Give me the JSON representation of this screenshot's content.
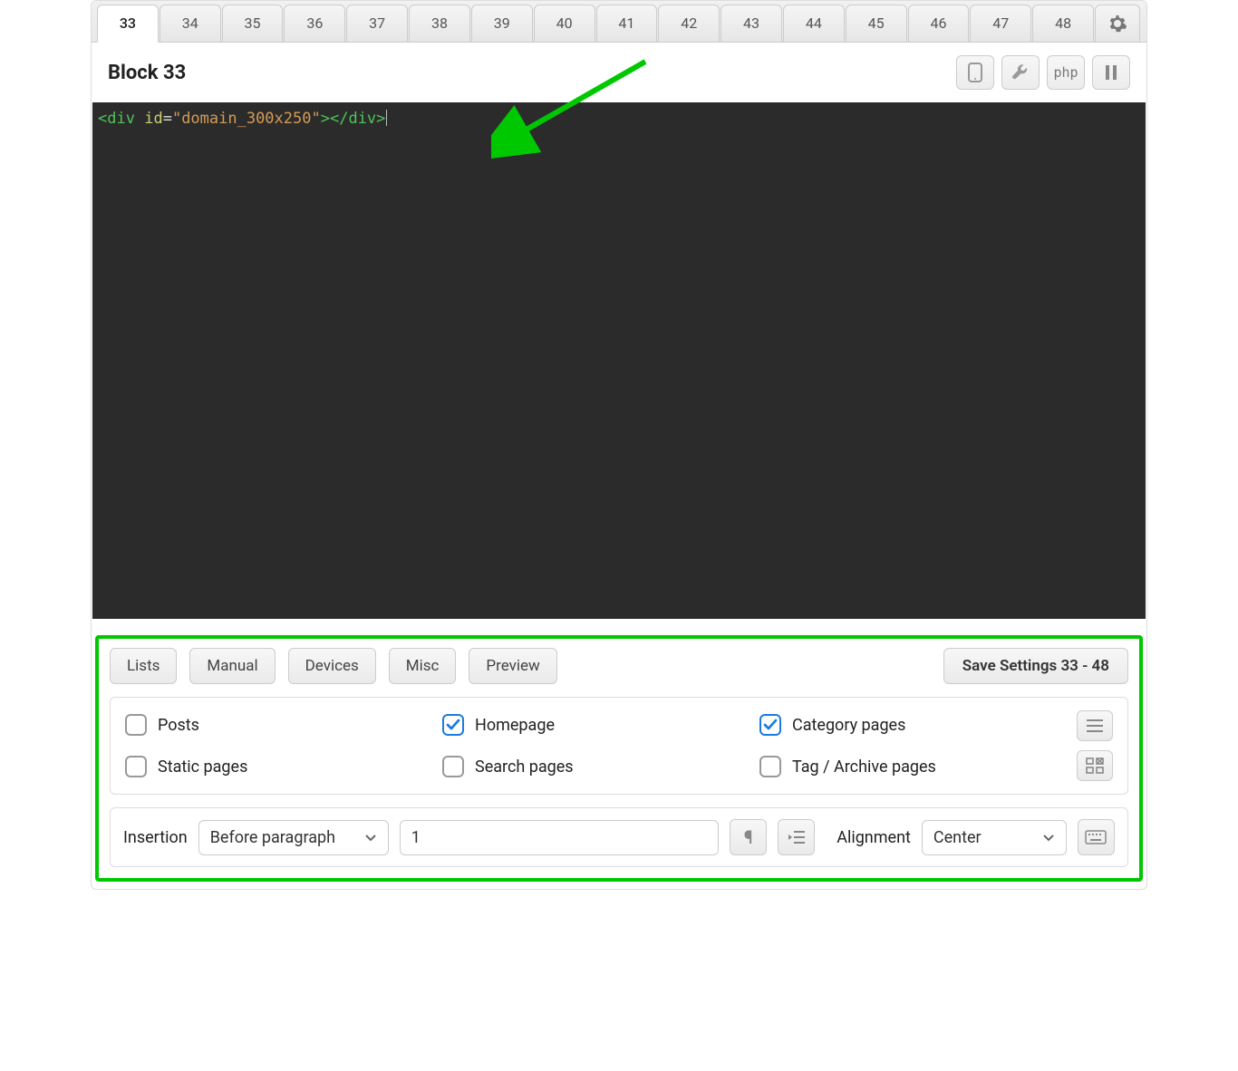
{
  "tabs": [
    "33",
    "34",
    "35",
    "36",
    "37",
    "38",
    "39",
    "40",
    "41",
    "42",
    "43",
    "44",
    "45",
    "46",
    "47",
    "48"
  ],
  "active_tab_index": 0,
  "block": {
    "title": "Block 33"
  },
  "toolbar": {
    "php_label": "php"
  },
  "code": {
    "open_br": "<",
    "tag": "div",
    "space": " ",
    "attr": "id",
    "eq": "=",
    "str": "\"domain_300x250\"",
    "close_br1": ">",
    "open_br2": "</",
    "tag2": "div",
    "close_br2": ">"
  },
  "bottom_buttons": {
    "lists": "Lists",
    "manual": "Manual",
    "devices": "Devices",
    "misc": "Misc",
    "preview": "Preview",
    "save": "Save Settings 33 - 48"
  },
  "placement": {
    "posts": {
      "label": "Posts",
      "checked": false
    },
    "static_pages": {
      "label": "Static pages",
      "checked": false
    },
    "homepage": {
      "label": "Homepage",
      "checked": true
    },
    "search_pages": {
      "label": "Search pages",
      "checked": false
    },
    "category_pages": {
      "label": "Category pages",
      "checked": true
    },
    "tag_archive": {
      "label": "Tag / Archive pages",
      "checked": false
    }
  },
  "insertion": {
    "label": "Insertion",
    "select_value": "Before paragraph",
    "number": "1",
    "alignment_label": "Alignment",
    "alignment_value": "Center"
  }
}
